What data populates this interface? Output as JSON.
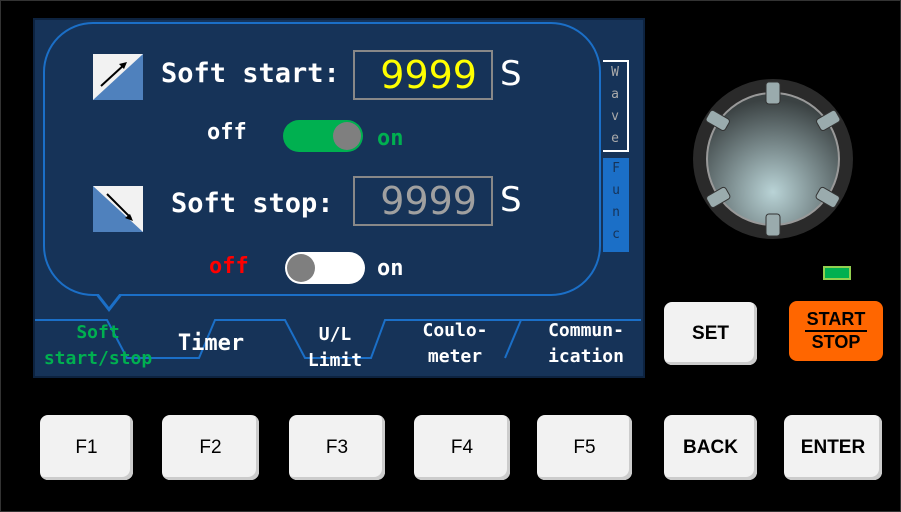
{
  "soft_start": {
    "label": "Soft start:",
    "value": "9999",
    "unit": "S",
    "off": "off",
    "on": "on",
    "enabled": true
  },
  "soft_stop": {
    "label": "Soft stop:",
    "value": "9999",
    "unit": "S",
    "off": "off",
    "on": "on",
    "enabled": false
  },
  "side_tabs": {
    "wave": [
      "W",
      "a",
      "v",
      "e"
    ],
    "func": [
      "F",
      "u",
      "n",
      "c"
    ]
  },
  "tabs": [
    {
      "l1": "Soft",
      "l2": "start/stop"
    },
    {
      "l1": "Timer",
      "l2": ""
    },
    {
      "l1": "U/L",
      "l2": "Limit"
    },
    {
      "l1": "Coulo-",
      "l2": "meter"
    },
    {
      "l1": "Commun-",
      "l2": "ication"
    }
  ],
  "buttons": {
    "set": "SET",
    "start": "START",
    "stop": "STOP",
    "f1": "F1",
    "f2": "F2",
    "f3": "F3",
    "f4": "F4",
    "f5": "F5",
    "back": "BACK",
    "enter": "ENTER"
  },
  "colors": {
    "active": "#00b050",
    "value_active": "#ffff00",
    "value_inactive": "#a0a0a0",
    "off_red": "#ff0000",
    "start_stop": "#ff6600",
    "led": "#00b050"
  }
}
